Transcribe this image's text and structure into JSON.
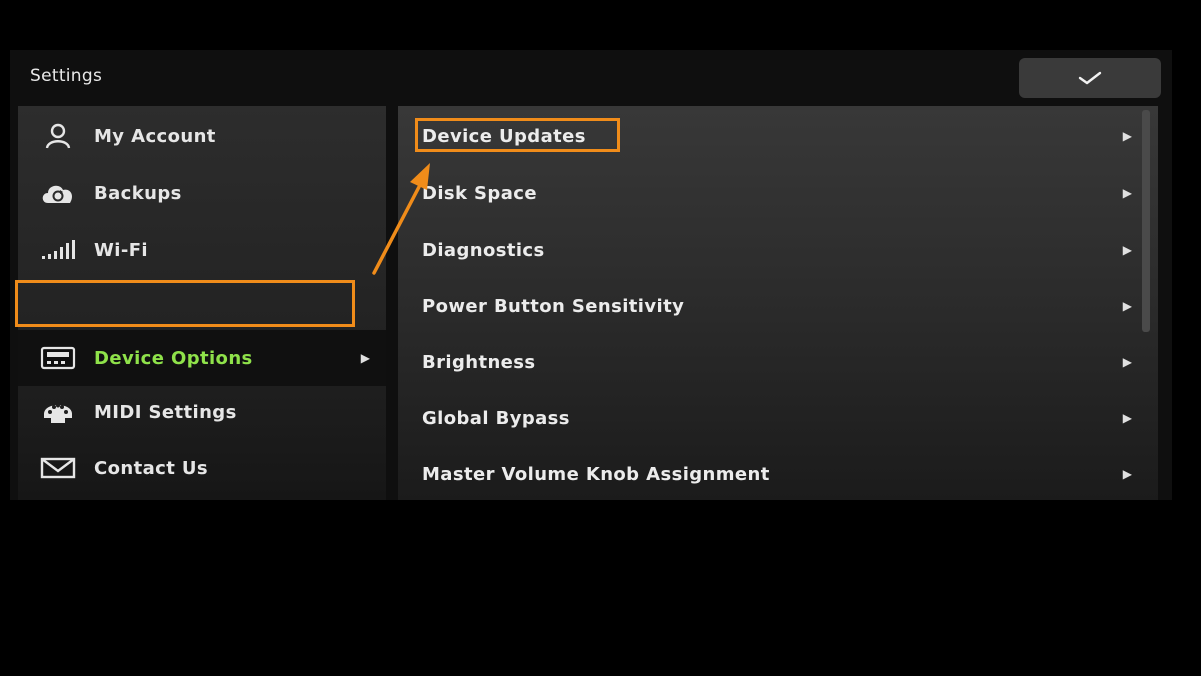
{
  "header": {
    "title": "Settings",
    "confirm_icon": "checkmark-icon"
  },
  "sidebar": {
    "items": [
      {
        "label": "My Account",
        "icon": "user-icon"
      },
      {
        "label": "Backups",
        "icon": "cloud-sync-icon"
      },
      {
        "label": "Wi-Fi",
        "icon": "signal-bars-icon"
      },
      {
        "label": "Device Options",
        "icon": "device-icon",
        "active": true
      },
      {
        "label": "MIDI Settings",
        "icon": "midi-connector-icon"
      },
      {
        "label": "Contact Us",
        "icon": "envelope-icon"
      }
    ]
  },
  "content": {
    "items": [
      {
        "label": "Device Updates"
      },
      {
        "label": "Disk Space"
      },
      {
        "label": "Diagnostics"
      },
      {
        "label": "Power Button Sensitivity"
      },
      {
        "label": "Brightness"
      },
      {
        "label": "Global Bypass"
      },
      {
        "label": "Master Volume Knob Assignment"
      }
    ]
  },
  "colors": {
    "accent_green": "#8fe24a",
    "highlight_orange": "#f08c1a",
    "background": "#000000"
  }
}
